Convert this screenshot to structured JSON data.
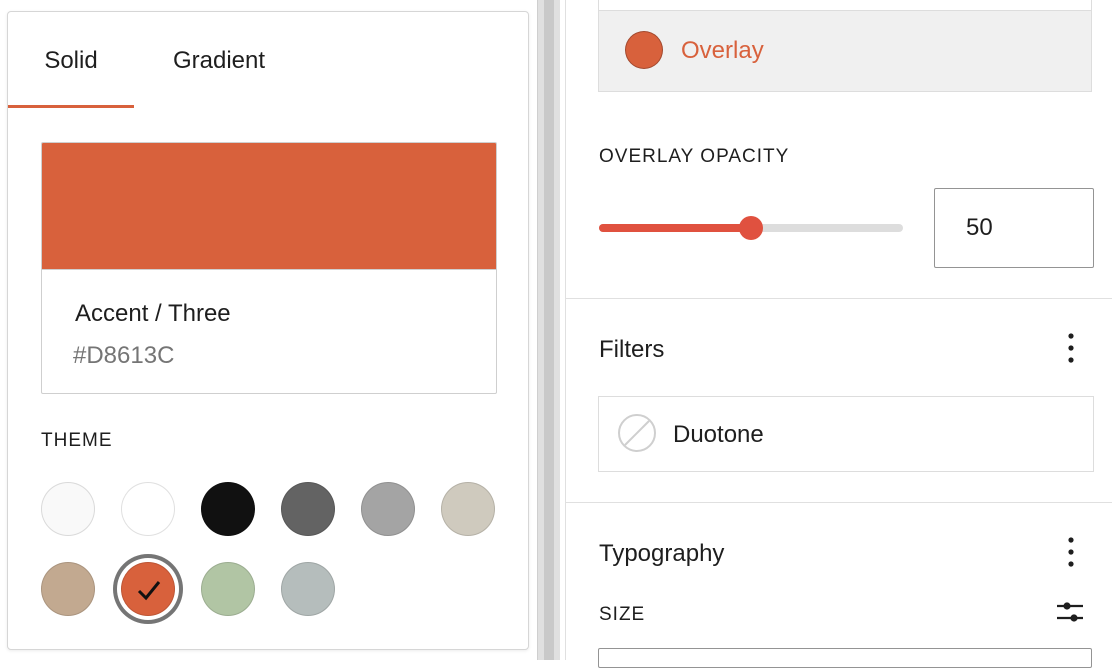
{
  "colors": {
    "accent": "#D8613C",
    "slider_track": "#dddddd"
  },
  "color_picker": {
    "tabs": [
      {
        "label": "Solid",
        "active": true
      },
      {
        "label": "Gradient",
        "active": false
      }
    ],
    "selected_color": {
      "name": "Accent / Three",
      "hex": "#D8613C"
    },
    "theme_label": "THEME",
    "theme_colors": [
      "#f9f9f9",
      "#ffffff",
      "#111111",
      "#636363",
      "#a4a4a4",
      "#cfcabe",
      "#c2a990",
      "#d8613c",
      "#b1c5a4",
      "#b5bdbc"
    ],
    "selected_index": 7
  },
  "sidebar": {
    "overlay": {
      "label": "Overlay",
      "color": "#D8613C"
    },
    "overlay_opacity": {
      "label": "OVERLAY OPACITY",
      "value": "50",
      "percent": 50
    },
    "filters": {
      "title": "Filters",
      "more_icon": "vertical-ellipsis-icon",
      "duotone_label": "Duotone",
      "duotone_icon": "no-color-icon"
    },
    "typography": {
      "title": "Typography",
      "more_icon": "vertical-ellipsis-icon",
      "size_label": "SIZE",
      "settings_icon": "sliders-icon"
    }
  }
}
